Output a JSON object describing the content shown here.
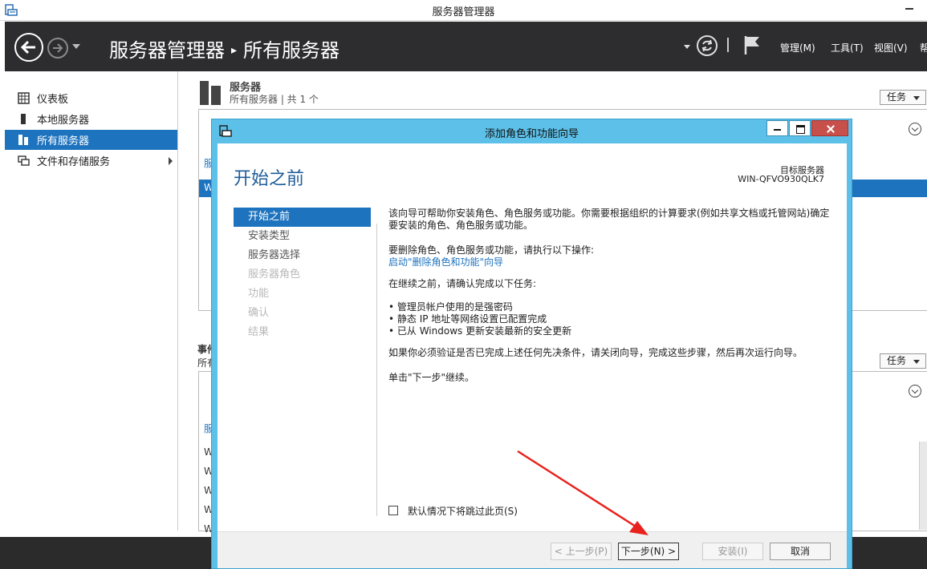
{
  "window": {
    "title": "服务器管理器"
  },
  "header": {
    "breadcrumb_root": "服务器管理器",
    "breadcrumb_separator": "▸",
    "breadcrumb_current": "所有服务器",
    "menus": [
      "管理(M)",
      "工具(T)",
      "视图(V)",
      "帮"
    ]
  },
  "sidebar": {
    "items": [
      {
        "label": "仪表板",
        "icon": "dashboard-icon",
        "active": false
      },
      {
        "label": "本地服务器",
        "icon": "server-icon",
        "active": false
      },
      {
        "label": "所有服务器",
        "icon": "servers-icon",
        "active": true
      },
      {
        "label": "文件和存储服务",
        "icon": "storage-icon",
        "active": false,
        "expandable": true
      }
    ]
  },
  "servers_panel": {
    "title": "服务器",
    "subtitle": "所有服务器 | 共 1 个",
    "tasks_label": "任务",
    "partial_col": "服",
    "partial_row": "W"
  },
  "events_panel": {
    "title_partial": "事件",
    "subtitle_partial": "所有",
    "tasks_label": "任务",
    "partial_col": "服",
    "partial_rows": [
      "W",
      "W",
      "W",
      "W",
      "W"
    ]
  },
  "dialog": {
    "title": "添加角色和功能向导",
    "heading": "开始之前",
    "target_label": "目标服务器",
    "target_name": "WIN-QFVO930QLK7",
    "steps": [
      {
        "label": "开始之前",
        "state": "active"
      },
      {
        "label": "安装类型",
        "state": "enabled"
      },
      {
        "label": "服务器选择",
        "state": "enabled"
      },
      {
        "label": "服务器角色",
        "state": "disabled"
      },
      {
        "label": "功能",
        "state": "disabled"
      },
      {
        "label": "确认",
        "state": "disabled"
      },
      {
        "label": "结果",
        "state": "disabled"
      }
    ],
    "intro_line1": "该向导可帮助你安装角色、角色服务或功能。你需要根据组织的计算要求(例如共享文档或托管网站)确定",
    "intro_line2": "要安装的角色、角色服务或功能。",
    "remove_text": "要删除角色、角色服务或功能，请执行以下操作:",
    "remove_link": "启动\"删除角色和功能\"向导",
    "confirm_text": "在继续之前，请确认完成以下任务:",
    "bullets": [
      "• 管理员帐户使用的是强密码",
      "• 静态 IP 地址等网络设置已配置完成",
      "• 已从 Windows 更新安装最新的安全更新"
    ],
    "verify_text": "如果你必须验证是否已完成上述任何先决条件，请关闭向导，完成这些步骤，然后再次运行向导。",
    "continue_text": "单击\"下一步\"继续。",
    "skip_checkbox_label": "默认情况下将跳过此页(S)",
    "buttons": {
      "prev": "< 上一步(P)",
      "next": "下一步(N) >",
      "install": "安装(I)",
      "cancel": "取消"
    }
  },
  "colors": {
    "accent": "#1e73be",
    "header_bg": "#2d2d30",
    "dialog_frame": "#5cc0e8",
    "annotation_arrow": "#e8231e"
  }
}
